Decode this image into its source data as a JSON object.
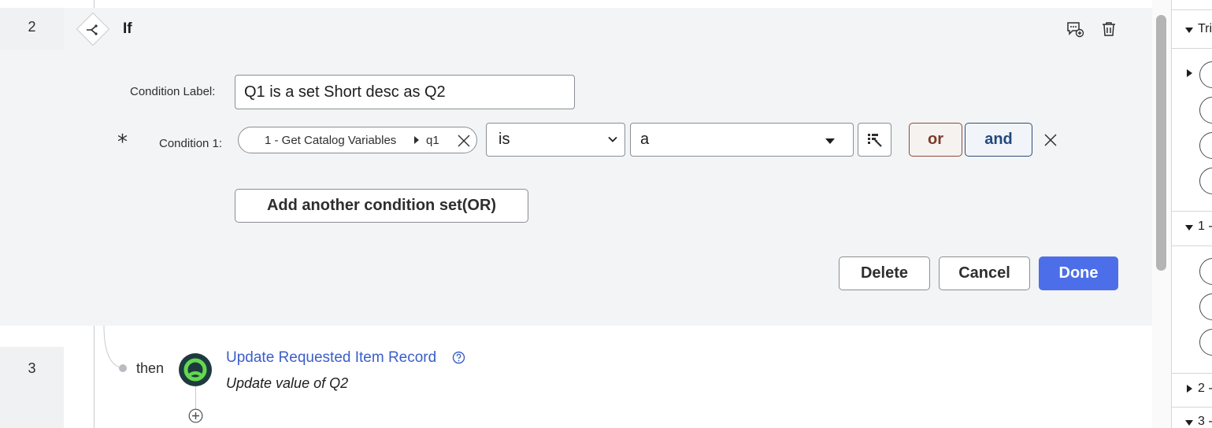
{
  "flow": {
    "step_numbers": {
      "if_step": "2",
      "action_step": "3"
    },
    "if_block": {
      "title": "If",
      "condition_label_caption": "Condition Label:",
      "condition_label_value": "Q1 is a set Short desc as Q2",
      "required_marker": "*",
      "condition_caption": "Condition 1:",
      "data_pill": {
        "source": "1 - Get Catalog Variables",
        "variable": "q1"
      },
      "operator": {
        "selected": "is"
      },
      "value": {
        "selected": "a"
      },
      "or_label": "or",
      "and_label": "and",
      "add_condition_set_label": "Add another condition set(OR)",
      "buttons": {
        "delete": "Delete",
        "cancel": "Cancel",
        "done": "Done"
      }
    },
    "then_block": {
      "connector_label": "then",
      "action_title": "Update Requested Item Record",
      "action_subtitle": "Update value of Q2"
    }
  },
  "right_panel": {
    "sections": [
      {
        "label": "Tri",
        "expanded": true
      },
      {
        "label": "1 -",
        "expanded": true
      },
      {
        "label": "2 -",
        "expanded": false
      },
      {
        "label": "3 -",
        "expanded": true
      }
    ]
  },
  "icons": {
    "if_node": "branch-icon",
    "header_actions": [
      "add-comment-icon",
      "trash-icon"
    ],
    "remove_pill": "close-icon",
    "operator_dropdown": "chevron-down-icon",
    "value_dropdown": "caret-down-icon",
    "data_picker": "data-picker-icon",
    "remove_condition": "close-icon",
    "action": "servicenow-record-icon",
    "help": "help-icon",
    "add_step": "plus-circle-icon"
  },
  "colors": {
    "done_button": "#4c6ee8",
    "or_accent": "#7b3b2a",
    "and_accent": "#23497d",
    "action_link": "#3b5dc9",
    "panel_background": "#f3f4f5",
    "action_icon_green": "#62d84e"
  }
}
